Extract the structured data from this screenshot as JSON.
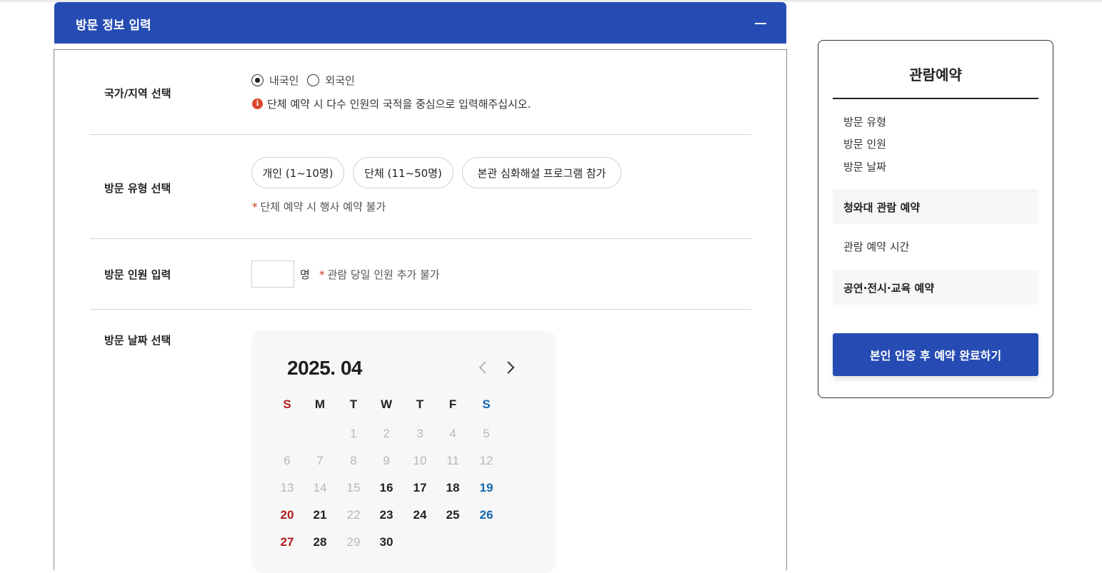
{
  "form": {
    "title": "방문 정보 입력",
    "country": {
      "label": "국가/지역 선택",
      "options": [
        "내국인",
        "외국인"
      ],
      "selected": "내국인",
      "notice": "단체 예약 시 다수 인원의 국적을 중심으로 입력해주십시오."
    },
    "visit_type": {
      "label": "방문 유형 선택",
      "options": [
        "개인 (1~10명)",
        "단체 (11~50명)",
        "본관 심화해설 프로그램 참가"
      ],
      "note": "단체 예약 시 행사 예약 불가"
    },
    "headcount": {
      "label": "방문 인원 입력",
      "value": "",
      "unit": "명",
      "note": "관람 당일 인원 추가 불가"
    },
    "date": {
      "label": "방문 날짜 선택"
    },
    "note_marker": "*"
  },
  "calendar": {
    "title": "2025. 04",
    "weekdays": [
      "S",
      "M",
      "T",
      "W",
      "T",
      "F",
      "S"
    ],
    "weeks": [
      [
        null,
        null,
        {
          "d": "1",
          "a": false
        },
        {
          "d": "2",
          "a": false
        },
        {
          "d": "3",
          "a": false
        },
        {
          "d": "4",
          "a": false
        },
        {
          "d": "5",
          "a": false
        }
      ],
      [
        {
          "d": "6",
          "a": false
        },
        {
          "d": "7",
          "a": false
        },
        {
          "d": "8",
          "a": false
        },
        {
          "d": "9",
          "a": false
        },
        {
          "d": "10",
          "a": false
        },
        {
          "d": "11",
          "a": false
        },
        {
          "d": "12",
          "a": false
        }
      ],
      [
        {
          "d": "13",
          "a": false
        },
        {
          "d": "14",
          "a": false
        },
        {
          "d": "15",
          "a": false
        },
        {
          "d": "16",
          "a": true
        },
        {
          "d": "17",
          "a": true
        },
        {
          "d": "18",
          "a": true
        },
        {
          "d": "19",
          "a": true
        }
      ],
      [
        {
          "d": "20",
          "a": true
        },
        {
          "d": "21",
          "a": true
        },
        {
          "d": "22",
          "a": false
        },
        {
          "d": "23",
          "a": true
        },
        {
          "d": "24",
          "a": true
        },
        {
          "d": "25",
          "a": true
        },
        {
          "d": "26",
          "a": true
        }
      ],
      [
        {
          "d": "27",
          "a": true
        },
        {
          "d": "28",
          "a": true
        },
        {
          "d": "29",
          "a": false
        },
        {
          "d": "30",
          "a": true
        },
        null,
        null,
        null
      ]
    ],
    "colors": {
      "sunday": "#b11c1c",
      "saturday": "#1466b0",
      "disabled": "#b8b8b8"
    }
  },
  "summary": {
    "title": "관람예약",
    "items": [
      "방문 유형",
      "방문 인원",
      "방문 날짜"
    ],
    "section1": "청와대 관람 예약",
    "section1_item": "관람 예약 시간",
    "section2": "공연·전시·교육 예약",
    "submit_label": "본인 인증 후 예약 완료하기"
  },
  "colors": {
    "accent": "#264cb3",
    "warning": "#d9472b"
  },
  "icons": {
    "collapse": "minus-icon",
    "info": "info-icon",
    "prev": "chevron-left-icon",
    "next": "chevron-right-icon"
  }
}
